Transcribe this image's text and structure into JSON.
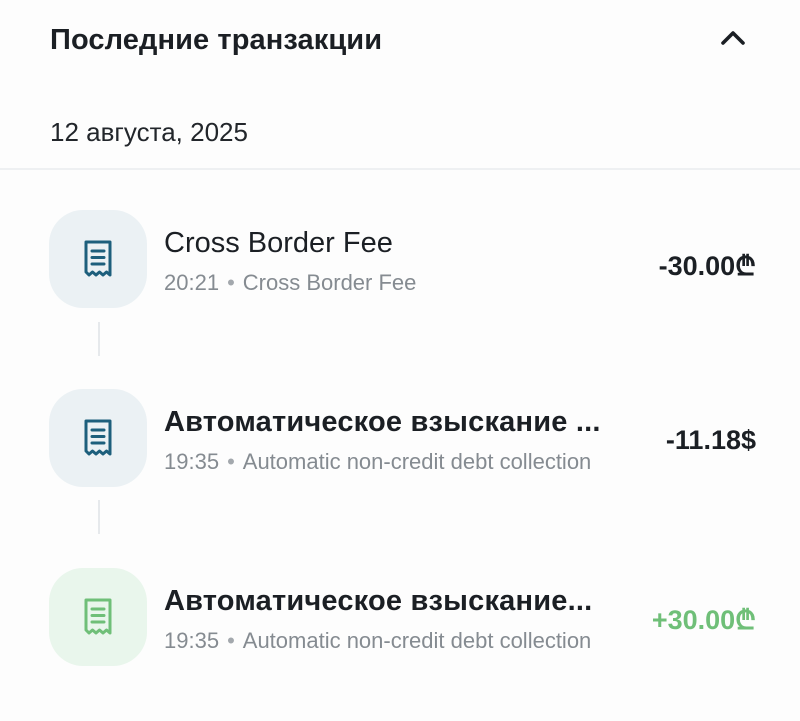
{
  "header": {
    "title": "Последние транзакции",
    "collapse_icon": "chevron-up-icon"
  },
  "date_group": "12 августа, 2025",
  "transactions": [
    {
      "title": "Cross Border Fee",
      "time": "20:21",
      "separator": "•",
      "description": "Cross Border Fee",
      "amount": "-30.00₾",
      "amount_color": "#1b1f24",
      "icon": "receipt-icon",
      "icon_color": "#1d5f7c",
      "icon_bg": "#ebf1f4"
    },
    {
      "title": "Автоматическое взыскание ...",
      "time": "19:35",
      "separator": "•",
      "description": "Automatic non-credit debt collection",
      "amount": "-11.18$",
      "amount_color": "#1b1f24",
      "icon": "receipt-icon",
      "icon_color": "#1d5f7c",
      "icon_bg": "#ebf1f4"
    },
    {
      "title": "Автоматическое взыскание...",
      "time": "19:35",
      "separator": "•",
      "description": "Automatic non-credit debt collection",
      "amount": "+30.00₾",
      "amount_color": "#6fbf78",
      "icon": "receipt-icon",
      "icon_color": "#6fbf78",
      "icon_bg": "#e9f6ec"
    }
  ]
}
